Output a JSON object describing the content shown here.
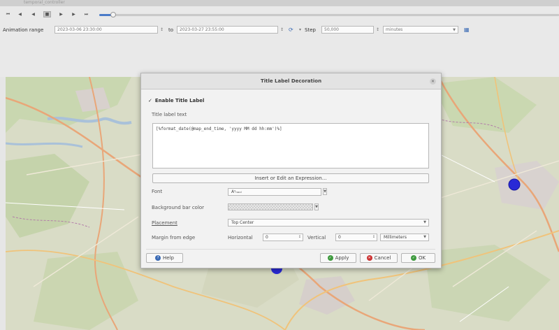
{
  "toolbar": {
    "window_title": "temporal_controller",
    "buttons": [
      "first-frame",
      "previous-frame",
      "stop",
      "play",
      "next-frame",
      "last-frame",
      "loop"
    ],
    "animation_range_label": "Animation range",
    "range_start": "2023-03-06 23:30:00",
    "to_label": "to",
    "range_end": "2023-03-27 23:55:00",
    "step_label": "Step",
    "step_value": "50,000",
    "step_unit": "minutes"
  },
  "dialog": {
    "title": "Title Label Decoration",
    "enable_label": "Enable Title Label",
    "text_label": "Title label text",
    "text_value": "[%format_date(@map_end_time, 'yyyy MM dd hh:mm')%]",
    "insert_button": "Insert or Edit an Expression...",
    "font_label": "Font",
    "font_value": "Aˢₙₐₓₗ",
    "bgcolor_label": "Background bar color",
    "placement_label": "Placement",
    "placement_value": "Top Center",
    "margin_label": "Margin from edge",
    "horizontal_label": "Horizontal",
    "horizontal_value": "0",
    "vertical_label": "Vertical",
    "vertical_value": "0",
    "margin_unit": "Millimeters",
    "help_button": "Help",
    "apply_button": "Apply",
    "cancel_button": "Cancel",
    "ok_button": "OK"
  },
  "colors": {
    "accent_blue": "#3b6bb5",
    "map_point": "#2929d6",
    "ok_green": "#3e9a3e",
    "cancel_red": "#cc3333"
  }
}
